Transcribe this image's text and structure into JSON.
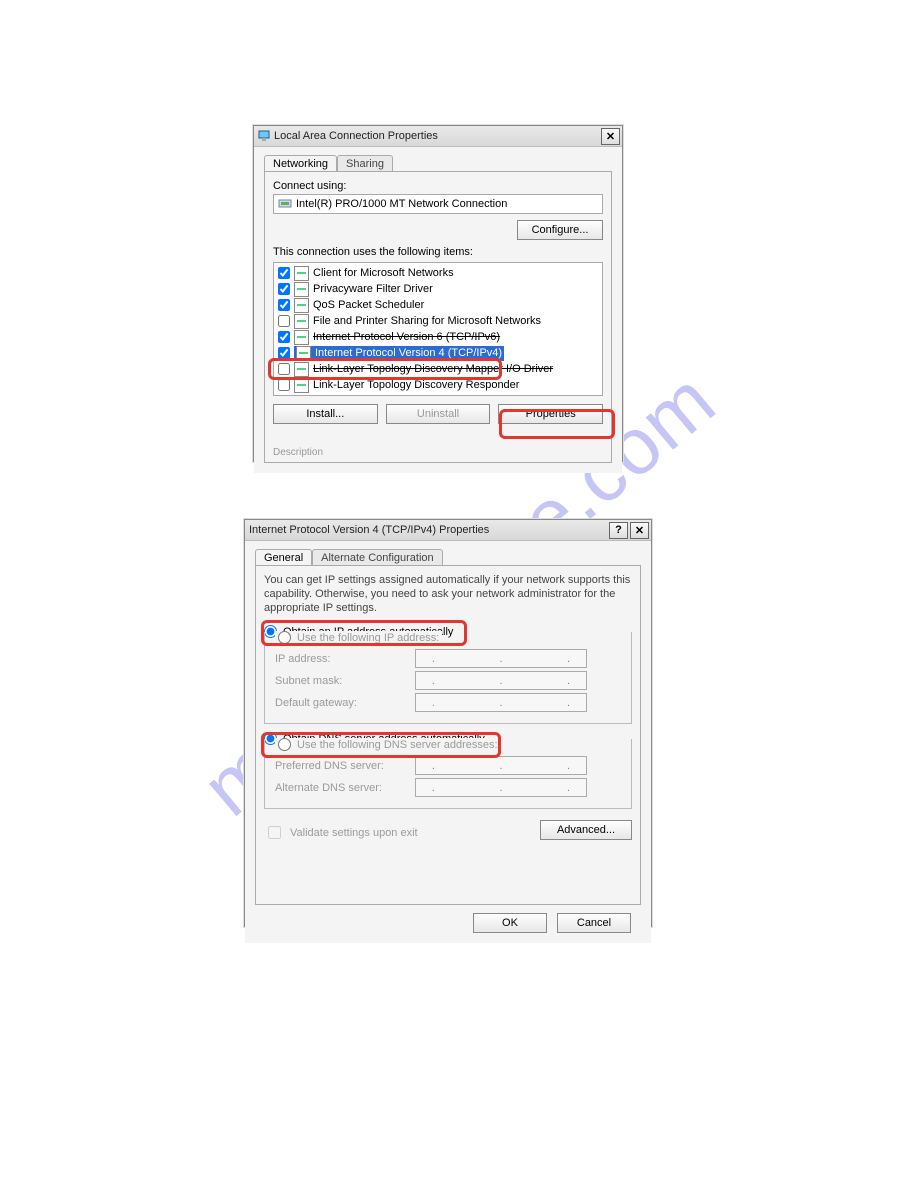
{
  "watermark": "manualshive.com",
  "dlg1": {
    "title": "Local Area Connection Properties",
    "tabs": {
      "networking": "Networking",
      "sharing": "Sharing"
    },
    "connect_using_label": "Connect using:",
    "adapter": "Intel(R) PRO/1000 MT Network Connection",
    "configure_btn": "Configure...",
    "items_label": "This connection uses the following items:",
    "items": [
      {
        "chk": true,
        "label": "Client for Microsoft Networks"
      },
      {
        "chk": true,
        "label": "Privacyware Filter Driver"
      },
      {
        "chk": true,
        "label": "QoS Packet Scheduler"
      },
      {
        "chk": false,
        "label": "File and Printer Sharing for Microsoft Networks"
      },
      {
        "chk": true,
        "label": "Internet Protocol Version 6 (TCP/IPv6)",
        "strike": true
      },
      {
        "chk": true,
        "label": "Internet Protocol Version 4 (TCP/IPv4)",
        "selected": true
      },
      {
        "chk": false,
        "label": "Link-Layer Topology Discovery Mapper I/O Driver",
        "strike": true
      },
      {
        "chk": false,
        "label": "Link-Layer Topology Discovery Responder"
      }
    ],
    "install_btn": "Install...",
    "uninstall_btn": "Uninstall",
    "properties_btn": "Properties",
    "description_heading": "Description"
  },
  "dlg2": {
    "title": "Internet Protocol Version 4 (TCP/IPv4) Properties",
    "tabs": {
      "general": "General",
      "alt": "Alternate Configuration"
    },
    "description": "You can get IP settings assigned automatically if your network supports this capability. Otherwise, you need to ask your network administrator for the appropriate IP settings.",
    "radio_ip_auto": "Obtain an IP address automatically",
    "radio_ip_manual": "Use the following IP address:",
    "ip_label": "IP address:",
    "subnet_label": "Subnet mask:",
    "gateway_label": "Default gateway:",
    "radio_dns_auto": "Obtain DNS server address automatically",
    "radio_dns_manual": "Use the following DNS server addresses:",
    "dns_pref_label": "Preferred DNS server:",
    "dns_alt_label": "Alternate DNS server:",
    "validate_label": "Validate settings upon exit",
    "advanced_btn": "Advanced...",
    "ok_btn": "OK",
    "cancel_btn": "Cancel"
  }
}
